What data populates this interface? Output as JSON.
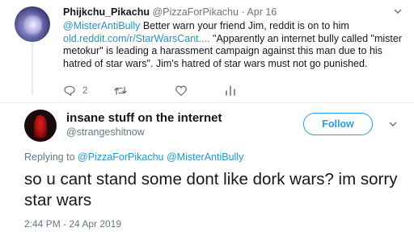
{
  "parent_tweet": {
    "display_name": "Phijkchu_Pikachu",
    "handle": "@PizzaForPikachu",
    "separator": "·",
    "date": "Apr 16",
    "mention": "@MisterAntiBully",
    "text_part1": " Better warn your friend Jim, reddit is on to him ",
    "link": "old.reddit.com/r/StarWarsCant....",
    "text_part2": " \"Apparently an internet bully called \"mister metokur\" is leading a harassment campaign against this man due to his hatred of star wars\". Jim's hatred of star wars must not go punished.",
    "reply_count": "2"
  },
  "main_tweet": {
    "display_name": "insane stuff on the internet",
    "handle": "@strangeshitnow",
    "follow_label": "Follow",
    "replying_prefix": "Replying to ",
    "reply_mention_1": "@PizzaForPikachu",
    "reply_mention_2": "@MisterAntiBully",
    "text": "so u cant stand some dont like dork wars? im sorry star wars",
    "timestamp": "2:44 PM - 24 Apr 2019"
  },
  "colors": {
    "accent": "#1da1f2",
    "link": "#1b95e0",
    "secondary_text": "#657786",
    "primary_text": "#14171a"
  },
  "icons": [
    "reply-icon",
    "retweet-icon",
    "like-icon",
    "analytics-icon",
    "chevron-down-icon"
  ]
}
